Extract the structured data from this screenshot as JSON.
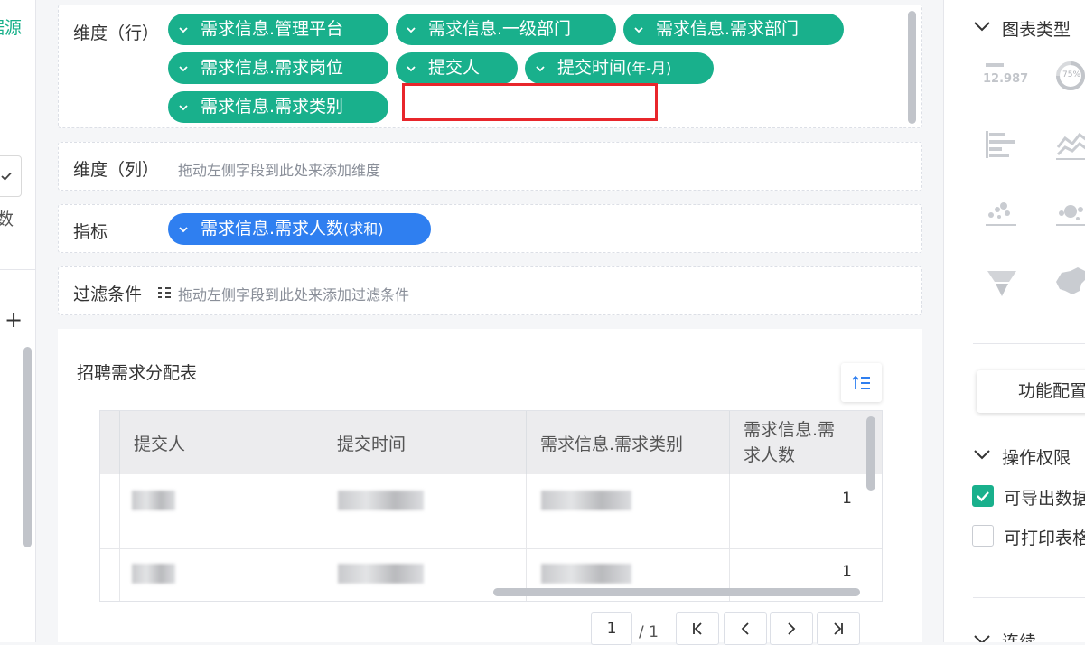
{
  "left": {
    "source_label": "据源",
    "count_label": "数",
    "add_label": "+"
  },
  "rows_zone": {
    "label": "维度（行）",
    "pills": [
      {
        "text": "需求信息.管理平台"
      },
      {
        "text": "需求信息.一级部门"
      },
      {
        "text": "需求信息.需求部门"
      },
      {
        "text": "需求信息.需求岗位"
      },
      {
        "text": "提交人"
      },
      {
        "text": "提交时间",
        "suffix": "(年-月)"
      },
      {
        "text": "需求信息.需求类别"
      }
    ]
  },
  "cols_zone": {
    "label": "维度（列）",
    "hint": "拖动左侧字段到此处来添加维度"
  },
  "metric_zone": {
    "label": "指标",
    "pill": {
      "text": "需求信息.需求人数",
      "suffix": "(求和)"
    }
  },
  "filter_zone": {
    "label": "过滤条件",
    "hint": "拖动左侧字段到此处来添加过滤条件"
  },
  "table": {
    "title": "招聘需求分配表",
    "headers": [
      "提交人",
      "提交时间",
      "需求信息.需求类别",
      "需求信息.需\n求人数"
    ],
    "header_line1": "需求信息.需",
    "header_line2": "求人数",
    "rows": [
      {
        "value": "1"
      },
      {
        "value": "1"
      }
    ]
  },
  "pagination": {
    "current": "1",
    "total": "/ 1",
    "first": "K",
    "prev": "<",
    "next": ">",
    "last": "K"
  },
  "right_panel": {
    "chart_type_title": "图表类型",
    "kpi_value": "12.987",
    "gauge_value": "75%",
    "func_button": "功能配置",
    "permissions_title": "操作权限",
    "perm_export": "可导出数据",
    "perm_print": "可打印表格",
    "link_title": "连续"
  },
  "colors": {
    "pill_green": "#19b08c",
    "pill_blue": "#2f7ff0",
    "highlight_red": "#e8262b"
  }
}
